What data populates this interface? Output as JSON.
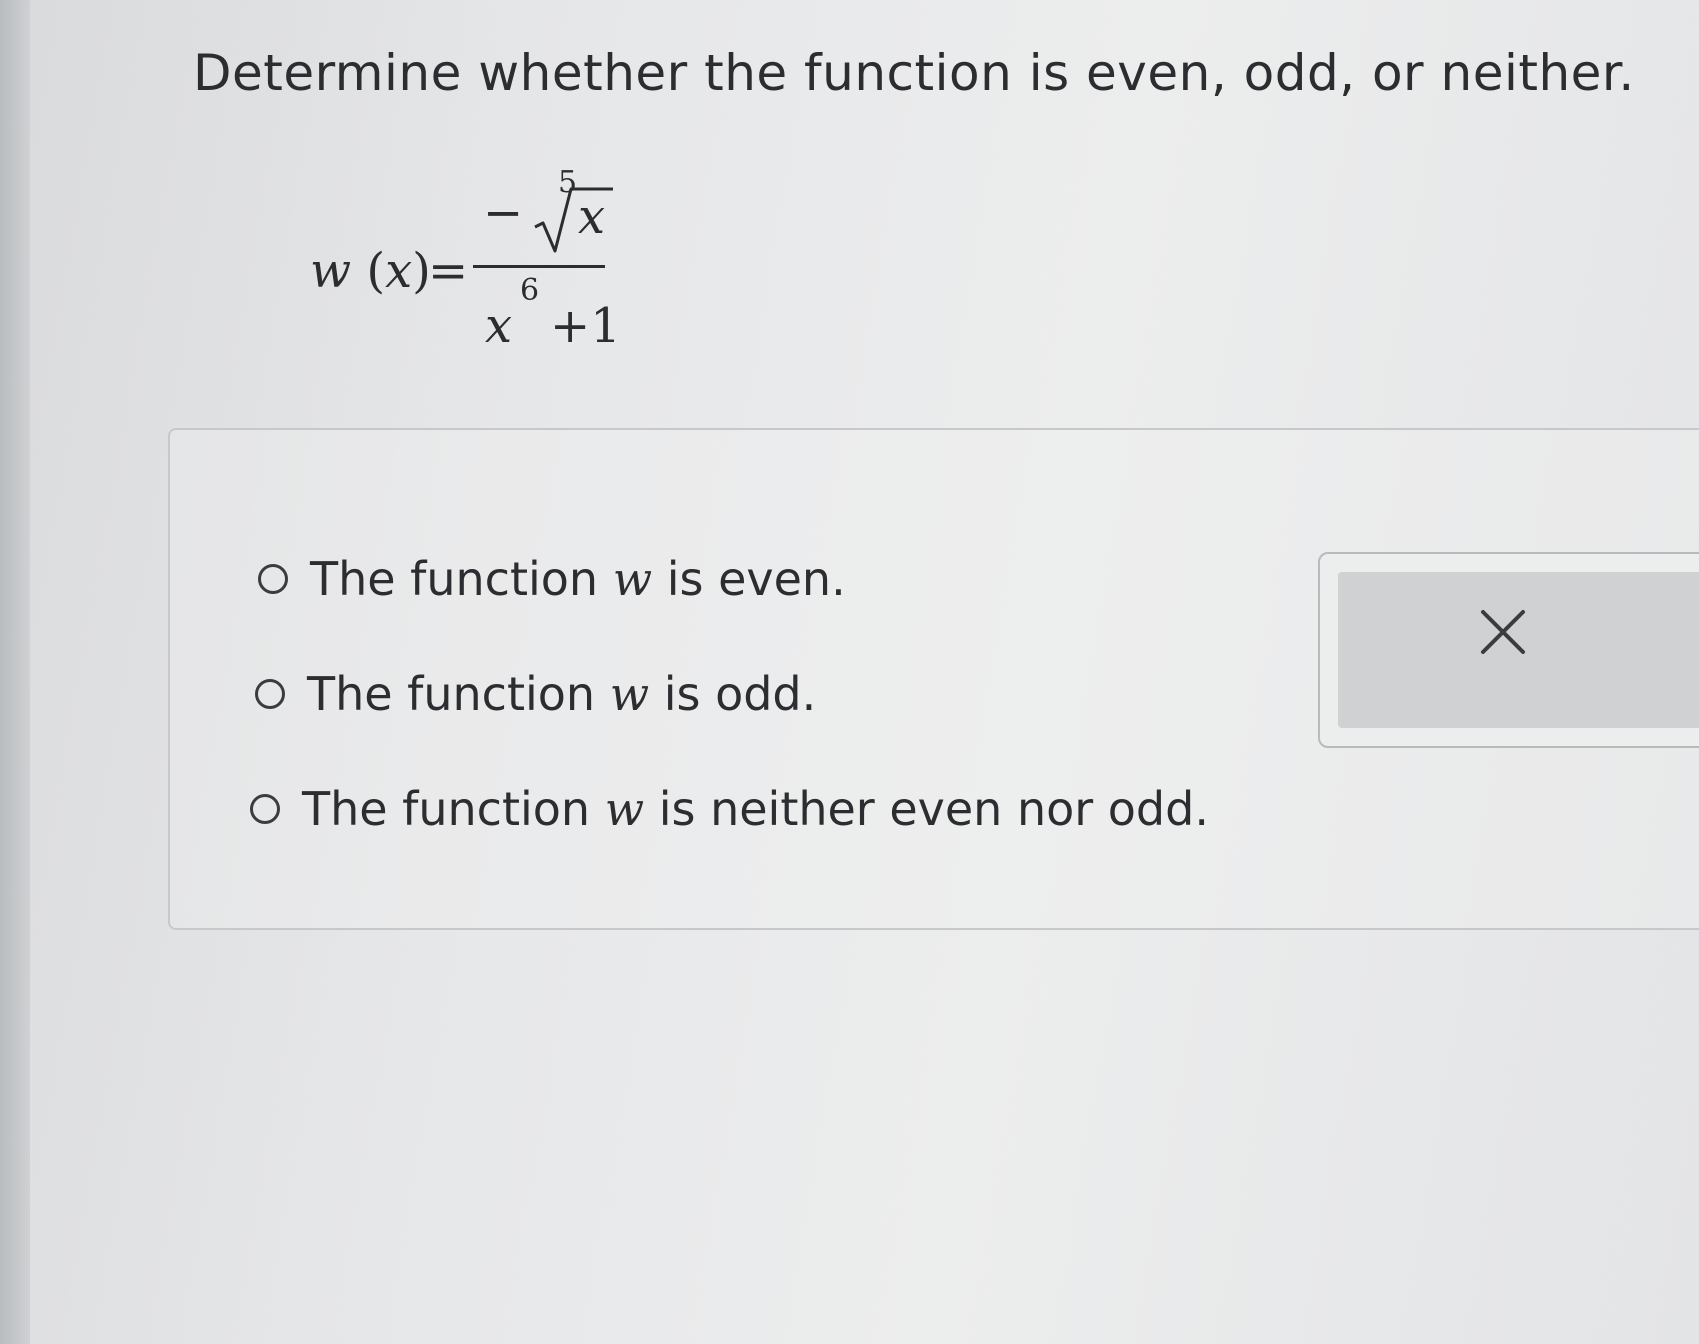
{
  "question": {
    "text": "Determine whether the function is even, odd, or neither."
  },
  "formula": {
    "function_name": "w",
    "variable": "x",
    "equals": "=",
    "numerator_sign": "−",
    "root_index": "5",
    "radicand": "x",
    "denominator_base": "x",
    "denominator_exponent": "6",
    "denominator_rest": "+1"
  },
  "options": [
    {
      "prefix": "The function ",
      "var": "w",
      "suffix": " is even.",
      "selected": false
    },
    {
      "prefix": "The function ",
      "var": "w",
      "suffix": " is odd.",
      "selected": false
    },
    {
      "prefix": "The function ",
      "var": "w",
      "suffix": " is neither even nor odd.",
      "selected": false
    }
  ],
  "feedback": {
    "icon": "close-icon"
  }
}
